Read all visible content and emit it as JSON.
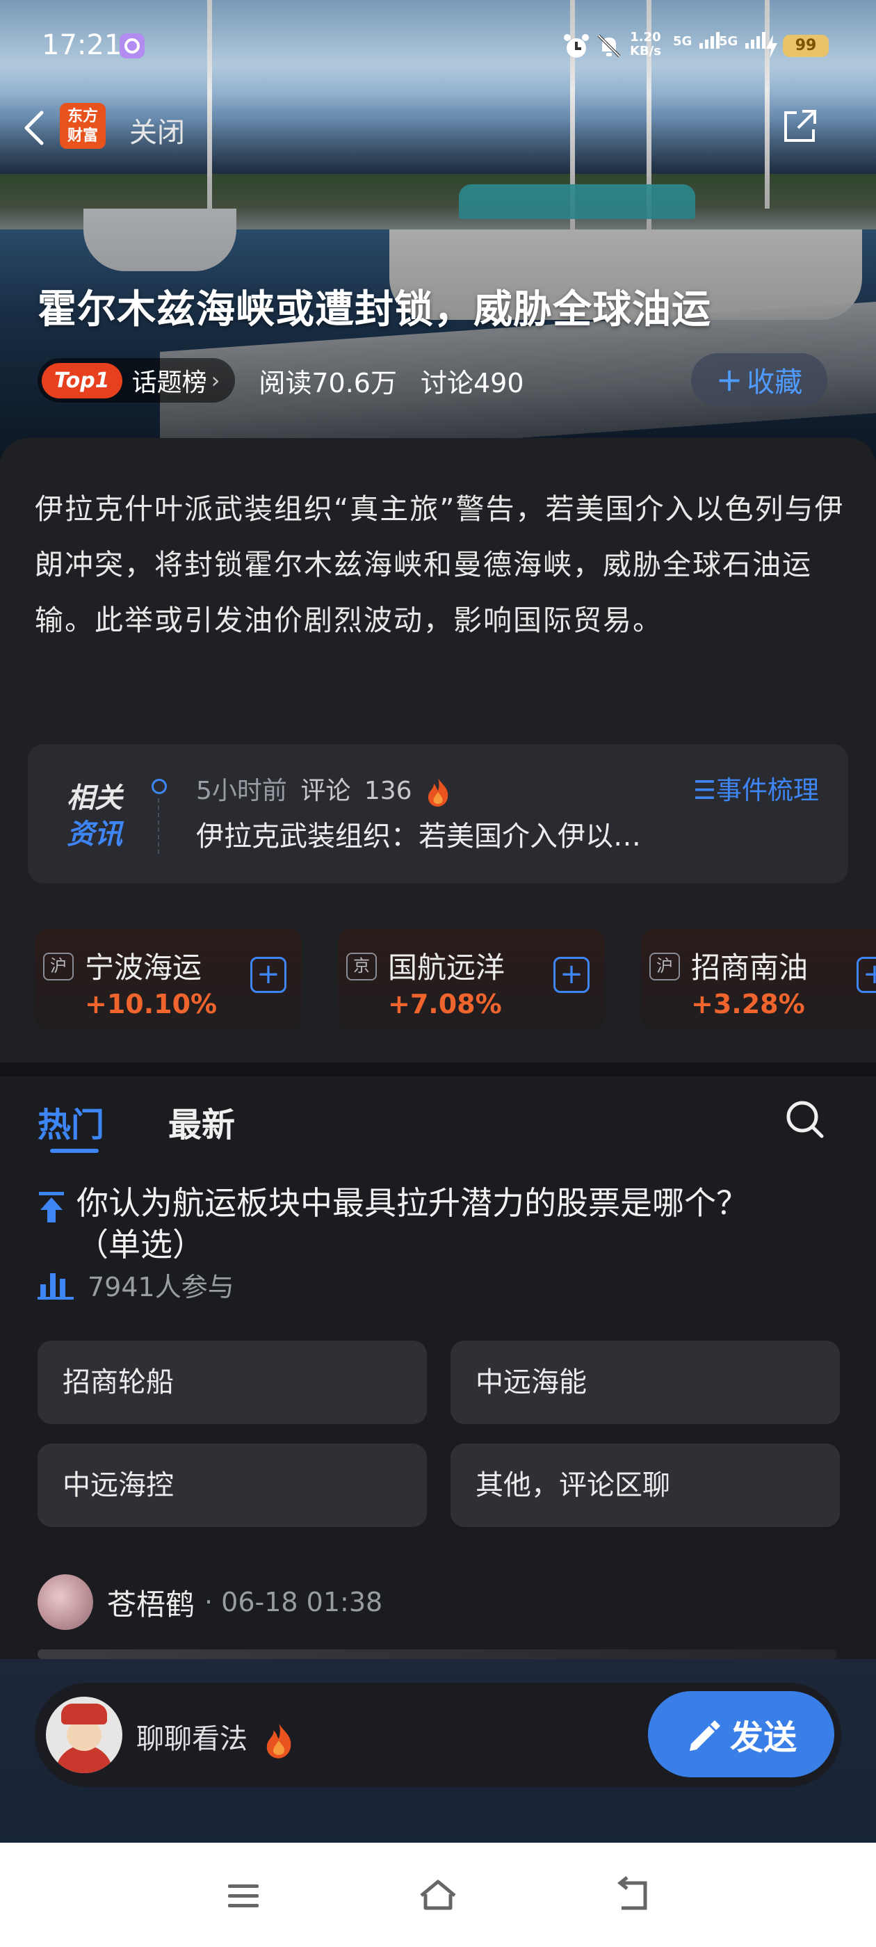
{
  "status_bar": {
    "time": "17:21",
    "net_speed_value": "1.20",
    "net_speed_unit": "KB/s",
    "sim1_label": "5G",
    "sim2_label": "5G",
    "battery_level": "99"
  },
  "header": {
    "logo_line1": "东方",
    "logo_line2": "财富",
    "close_label": "关闭",
    "title": "霍尔木兹海峡或遭封锁，威胁全球油运",
    "rank_badge": "Top1",
    "rank_list_label": "话题榜",
    "rank_chevron": "›",
    "reads": "阅读70.6万",
    "discussions": "讨论490",
    "favorite_label": "收藏",
    "favorite_plus": "+"
  },
  "summary": "伊拉克什叶派武装组织“真主旅”警告，若美国介入以色列与伊朗冲突，将封锁霍尔木兹海峡和曼德海峡，威胁全球石油运输。此举或引发油价剧烈波动，影响国际贸易。",
  "related_news": {
    "label_line1": "相关",
    "label_line2": "资讯",
    "time_ago": "5小时前",
    "comments_label": "评论",
    "comments_count": "136",
    "headline": "伊拉克武装组织：若美国介入伊以…",
    "timeline_link": "事件梳理"
  },
  "stocks": [
    {
      "market": "沪",
      "name": "宁波海运",
      "change": "+10.10%"
    },
    {
      "market": "京",
      "name": "国航远洋",
      "change": "+7.08%"
    },
    {
      "market": "沪",
      "name": "招商南油",
      "change": "+3.28%"
    }
  ],
  "tabs": {
    "hot": "热门",
    "latest": "最新"
  },
  "poll": {
    "question": "你认为航运板块中最具拉升潜力的股票是哪个？ （单选）",
    "participants": "7941人参与",
    "options": [
      "招商轮船",
      "中远海能",
      "中远海控",
      "其他，评论区聊"
    ]
  },
  "comment_preview": {
    "author": "苍梧鹤",
    "datetime": "· 06-18 01:38"
  },
  "composer": {
    "placeholder": "聊聊看法",
    "send_label": "发送"
  },
  "colors": {
    "accent_blue": "#3e86f5",
    "rise_orange": "#f0642e",
    "brand_orange": "#e8521c"
  }
}
